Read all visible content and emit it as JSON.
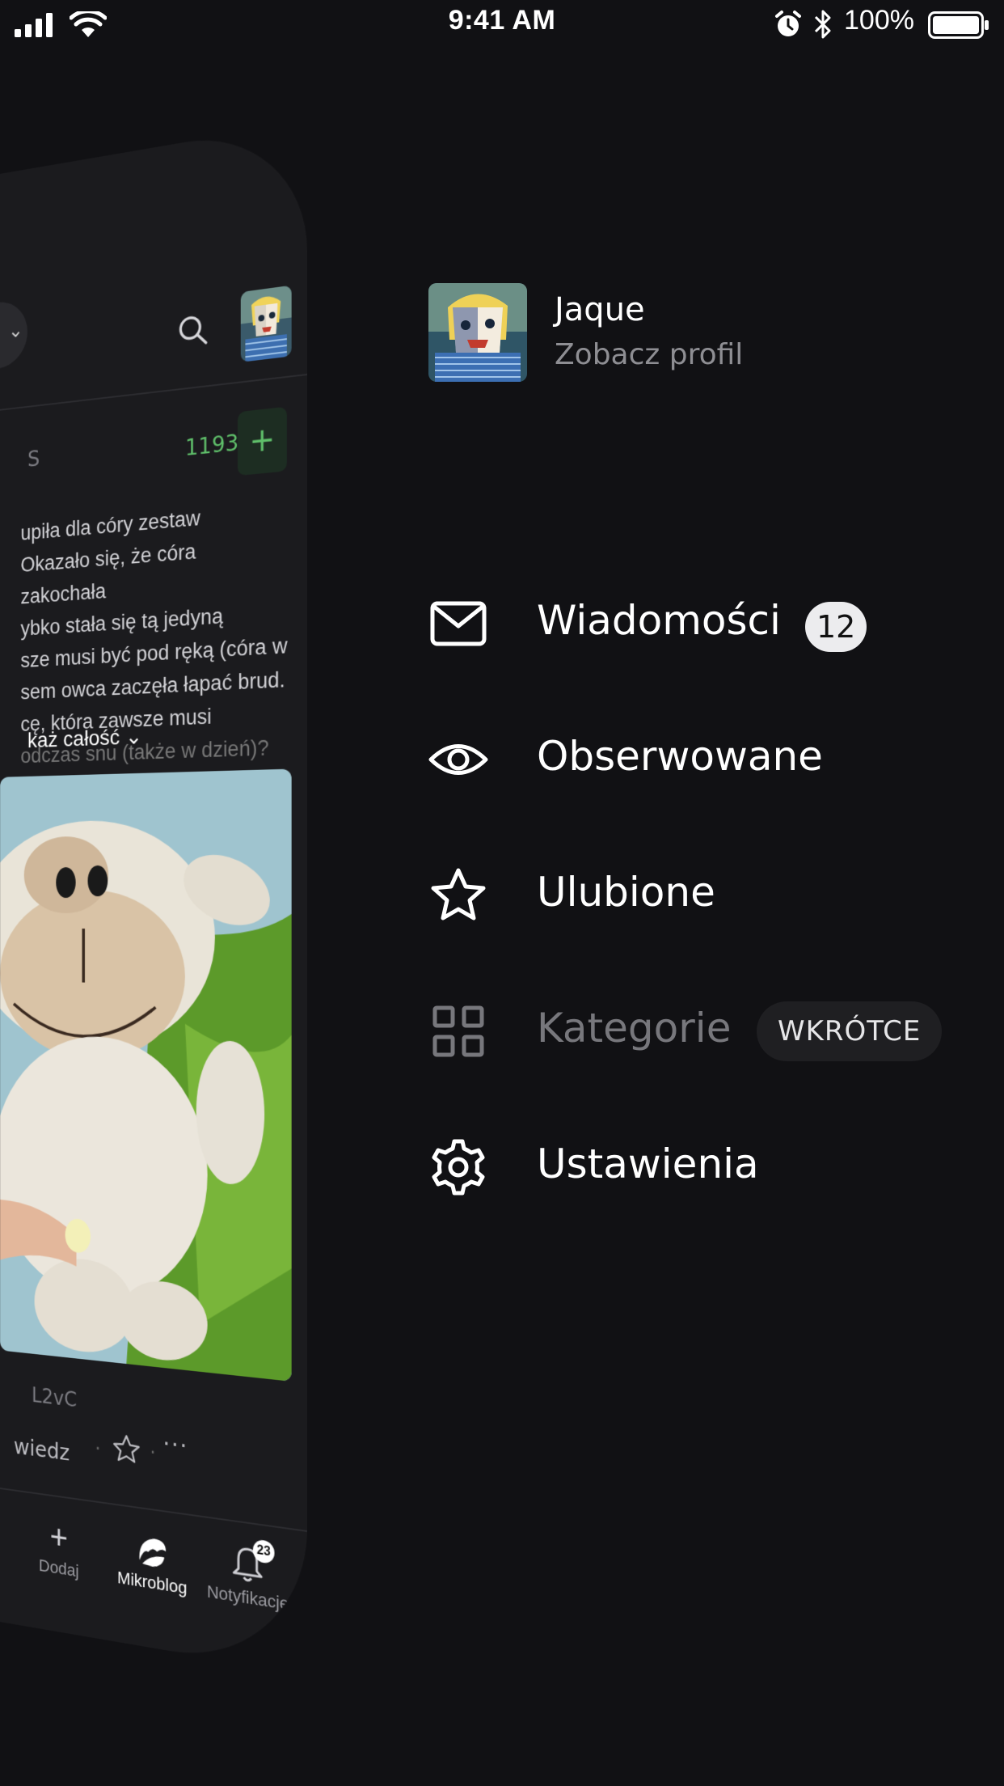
{
  "status_bar": {
    "time": "9:41 AM",
    "battery": "100%"
  },
  "background_app": {
    "post_votes": "1193",
    "post_author_partial": "S",
    "post_text_lines": [
      "upiła dla córy zestaw",
      "Okazało się, że córa zakochała",
      "ybko stała się tą jedyną",
      "sze musi być pod ręką (córa w",
      "sem owca zaczęła łapać brud.",
      "cę, która zawsze musi",
      "odczas snu (także w dzień)?"
    ],
    "show_more": "każ całość",
    "post_id_partial": "L2vC",
    "reply_partial": "wiedz",
    "tabs": [
      {
        "label": "Dodaj",
        "icon": "plus-icon"
      },
      {
        "label": "Mikroblog",
        "icon": "croissant-icon"
      },
      {
        "label": "Notyfikacje",
        "icon": "bell-icon",
        "badge": "23"
      }
    ]
  },
  "profile": {
    "name": "Jaque",
    "link": "Zobacz profil"
  },
  "menu": {
    "items": [
      {
        "label": "Wiadomości",
        "icon": "envelope-icon",
        "badge": "12"
      },
      {
        "label": "Obserwowane",
        "icon": "eye-icon"
      },
      {
        "label": "Ulubione",
        "icon": "star-icon"
      },
      {
        "label": "Kategorie",
        "icon": "grid-icon",
        "tag": "WKRÓTCE",
        "disabled": true
      },
      {
        "label": "Ustawienia",
        "icon": "gear-icon"
      }
    ]
  }
}
